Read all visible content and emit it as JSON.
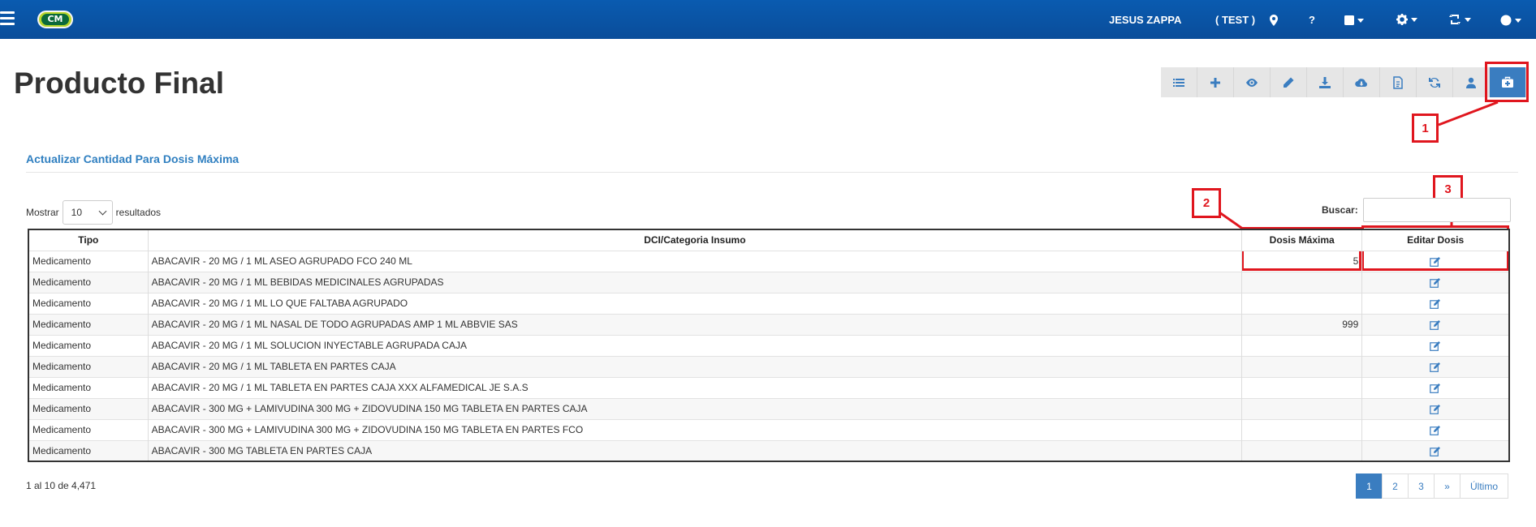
{
  "nav": {
    "logo_text": "CM",
    "user": "JESUS ZAPPA",
    "env": "( TEST )",
    "help": "?"
  },
  "page": {
    "title": "Producto Final",
    "section_title": "Actualizar Cantidad Para Dosis Máxima"
  },
  "controls": {
    "show_label": "Mostrar",
    "page_size": "10",
    "results_label": "resultados",
    "search_label": "Buscar:"
  },
  "table": {
    "headers": [
      "Tipo",
      "DCI/Categoria Insumo",
      "Dosis Máxima",
      "Editar Dosis"
    ],
    "rows": [
      {
        "tipo": "Medicamento",
        "dci": "ABACAVIR - 20 MG / 1 ML ASEO AGRUPADO FCO 240 ML",
        "dosis": "5"
      },
      {
        "tipo": "Medicamento",
        "dci": "ABACAVIR - 20 MG / 1 ML BEBIDAS MEDICINALES AGRUPADAS",
        "dosis": ""
      },
      {
        "tipo": "Medicamento",
        "dci": "ABACAVIR - 20 MG / 1 ML LO QUE FALTABA AGRUPADO",
        "dosis": ""
      },
      {
        "tipo": "Medicamento",
        "dci": "ABACAVIR - 20 MG / 1 ML NASAL DE TODO AGRUPADAS AMP 1 ML ABBVIE SAS",
        "dosis": "999"
      },
      {
        "tipo": "Medicamento",
        "dci": "ABACAVIR - 20 MG / 1 ML SOLUCION INYECTABLE AGRUPADA CAJA",
        "dosis": ""
      },
      {
        "tipo": "Medicamento",
        "dci": "ABACAVIR - 20 MG / 1 ML TABLETA EN PARTES CAJA",
        "dosis": ""
      },
      {
        "tipo": "Medicamento",
        "dci": "ABACAVIR - 20 MG / 1 ML TABLETA EN PARTES CAJA XXX ALFAMEDICAL JE S.A.S",
        "dosis": ""
      },
      {
        "tipo": "Medicamento",
        "dci": "ABACAVIR - 300 MG + LAMIVUDINA 300 MG + ZIDOVUDINA 150 MG TABLETA EN PARTES CAJA",
        "dosis": ""
      },
      {
        "tipo": "Medicamento",
        "dci": "ABACAVIR - 300 MG + LAMIVUDINA 300 MG + ZIDOVUDINA 150 MG TABLETA EN PARTES FCO",
        "dosis": ""
      },
      {
        "tipo": "Medicamento",
        "dci": "ABACAVIR - 300 MG TABLETA EN PARTES CAJA",
        "dosis": ""
      }
    ]
  },
  "footer": {
    "info": "1 al 10 de 4,471",
    "pages": [
      "1",
      "2",
      "3",
      "»",
      "Último"
    ]
  },
  "annotations": [
    "1",
    "2",
    "3"
  ],
  "colors": {
    "navbar": "#0a4d9a",
    "accent": "#3a7dc0",
    "annotation": "#e0161e"
  }
}
